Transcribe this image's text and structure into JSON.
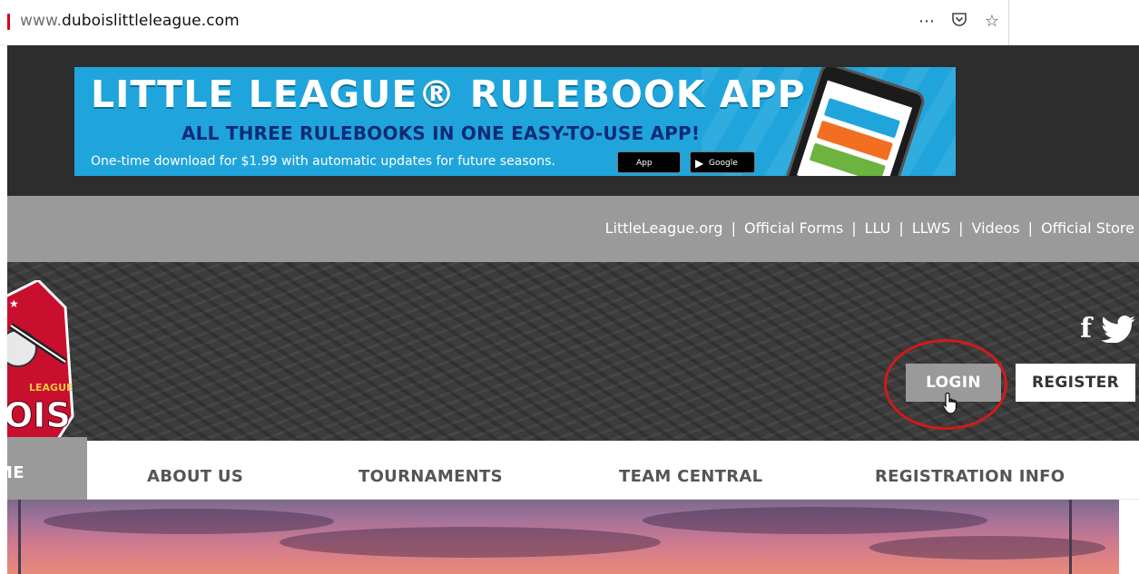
{
  "browser": {
    "url_prefix": "www.",
    "url_domain": "duboislittleleague.com",
    "icons": [
      "more-icon",
      "pocket-icon",
      "bookmark-star-icon"
    ]
  },
  "ad": {
    "title": "LITTLE LEAGUE® RULEBOOK APP",
    "subtitle": "ALL THREE RULEBOOKS IN ONE EASY-TO-USE APP!",
    "line": "One-time download for $1.99 with automatic updates for future seasons.",
    "app_store": "App Store",
    "google_play": "Google Play",
    "colors": {
      "background": "#1fa5dc",
      "subtitle": "#0e2a78"
    }
  },
  "top_links": [
    {
      "label": "LittleLeague.org"
    },
    {
      "label": "Official Forms"
    },
    {
      "label": "LLU"
    },
    {
      "label": "LLWS"
    },
    {
      "label": "Videos"
    },
    {
      "label": "Official Store"
    }
  ],
  "header": {
    "logo_text_top": "LEAGUE",
    "logo_text_bottom": "OIS",
    "login_label": "LOGIN",
    "register_label": "REGISTER",
    "social": [
      "facebook-icon",
      "twitter-icon"
    ]
  },
  "nav": {
    "home": "ME",
    "about": "ABOUT US",
    "tournaments": "TOURNAMENTS",
    "team_central": "TEAM CENTRAL",
    "registration": "REGISTRATION INFO"
  },
  "colors": {
    "grey_bar": "#9a9a9a",
    "dark_band": "#2d2d2d",
    "highlight": "#d11a1a"
  }
}
